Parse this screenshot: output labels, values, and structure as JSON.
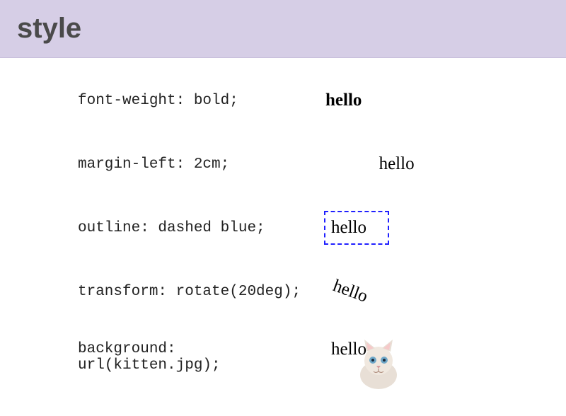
{
  "header": {
    "title": "style"
  },
  "rows": [
    {
      "code": "font-weight: bold;",
      "text": "hello"
    },
    {
      "code": "margin-left: 2cm;",
      "text": "hello"
    },
    {
      "code": "outline: dashed blue;",
      "text": "hello"
    },
    {
      "code": "transform: rotate(20deg);",
      "text": "hello"
    },
    {
      "code": "background: url(kitten.jpg);",
      "text": "hello"
    }
  ]
}
